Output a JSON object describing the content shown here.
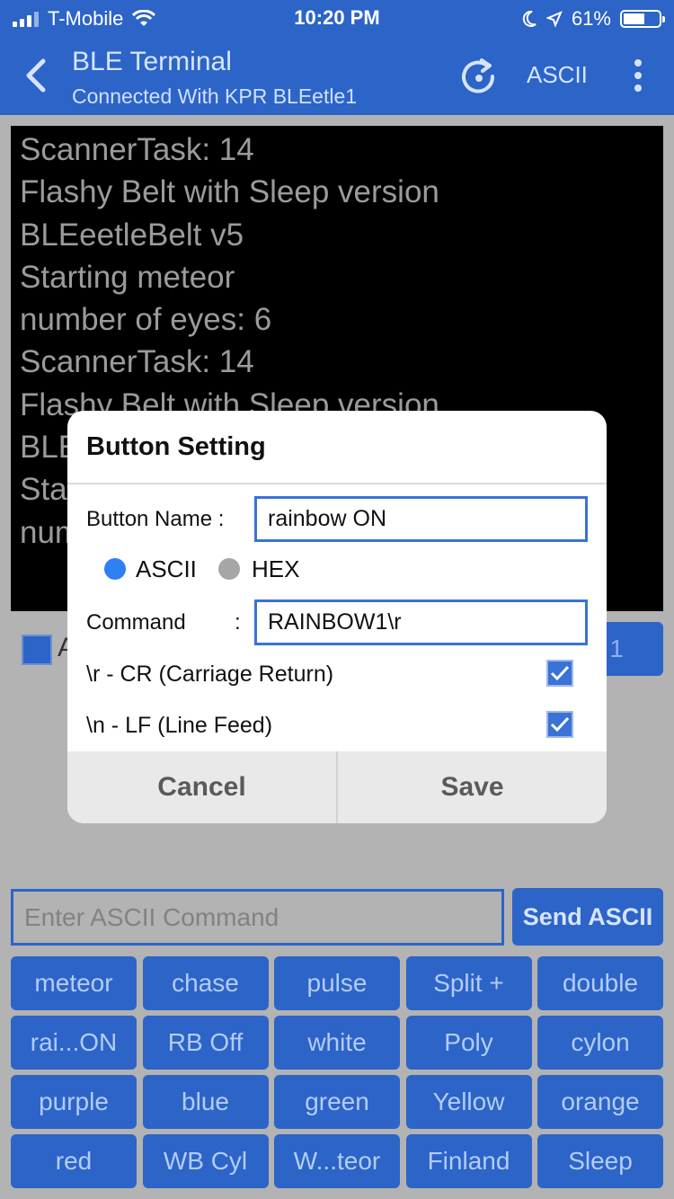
{
  "status": {
    "carrier": "T-Mobile",
    "time": "10:20 PM",
    "battery_text": "61%",
    "battery_level": 0.61
  },
  "nav": {
    "title": "BLE Terminal",
    "subtitle": "Connected With KPR BLEetle1",
    "mode": "ASCII"
  },
  "terminal": {
    "lines": [
      "ScannerTask: 14",
      "Flashy Belt with Sleep version",
      "BLEeetleBelt v5",
      "Starting meteor",
      "number of eyes: 6",
      "ScannerTask: 14",
      "Flashy Belt with Sleep version",
      "BLEeetleBelt v5",
      "Starting meteor",
      "number of eyes: 6"
    ]
  },
  "behind": {
    "auto_label": "A",
    "button_partial": "1"
  },
  "command": {
    "placeholder": "Enter ASCII Command",
    "send_label": "Send ASCII"
  },
  "buttons": [
    "meteor",
    "chase",
    "pulse",
    "Split +",
    "double",
    "rai...ON",
    "RB Off",
    "white",
    "Poly",
    "cylon",
    "purple",
    "blue",
    "green",
    "Yellow",
    "orange",
    "red",
    "WB Cyl",
    "W...teor",
    "Finland",
    "Sleep"
  ],
  "dialog": {
    "title": "Button Setting",
    "name_label": "Button Name :",
    "name_value": "rainbow ON",
    "radio_ascii": "ASCII",
    "radio_hex": "HEX",
    "selected_format": "ASCII",
    "command_label": "Command",
    "command_colon": ":",
    "command_value": "RAINBOW1\\r",
    "cr_label": "\\r - CR (Carriage Return)",
    "lf_label": "\\n - LF (Line Feed)",
    "cr_checked": true,
    "lf_checked": true,
    "cancel": "Cancel",
    "save": "Save"
  },
  "colors": {
    "accent": "#2c64c8",
    "background": "#b3b3b3",
    "terminal_bg": "#000000",
    "terminal_text": "#9b9b9b"
  }
}
